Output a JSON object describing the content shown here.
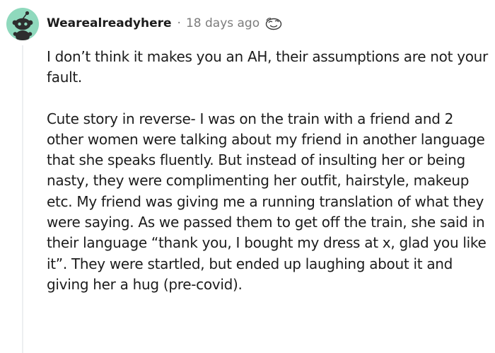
{
  "comment": {
    "username": "Wearealreadyhere",
    "separator": "·",
    "timestamp": "18 days ago",
    "award_icon": "wink-award-icon",
    "paragraphs": [
      "I don’t think it makes you an AH, their assumptions are not your fault.",
      "Cute story in reverse- I was on the train with a friend and 2 other women were talking about my friend in another language that she speaks fluently. But instead of insulting her or being nasty, they were complimenting her outfit, hairstyle, makeup etc. My friend was giving me a running translation of what they were saying. As we passed them to get off the train, she said in their language “thank you, I bought my dress at x, glad you like it”. They were startled, but ended up laughing about it and giving her a hug (pre-covid)."
    ]
  },
  "colors": {
    "avatar_bg": "#8fd9bd",
    "text": "#1c1c1c",
    "meta": "#7c7c7c",
    "thread_line": "#edeff1"
  }
}
